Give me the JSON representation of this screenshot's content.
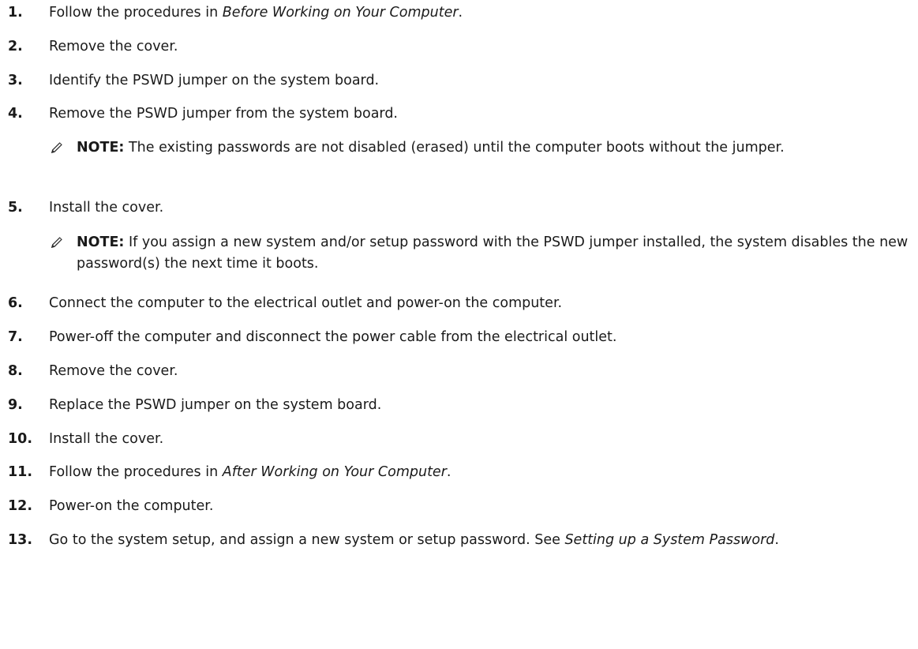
{
  "steps": [
    {
      "num": "1.",
      "before": "Follow the procedures in ",
      "italic": "Before Working on Your Computer",
      "after": "."
    },
    {
      "num": "2.",
      "text": "Remove the cover."
    },
    {
      "num": "3.",
      "text": "Identify the PSWD jumper on the system board."
    },
    {
      "num": "4.",
      "text": "Remove the PSWD jumper from the system board."
    },
    {
      "num": "5.",
      "text": "Install the cover."
    },
    {
      "num": "6.",
      "text": "Connect the computer to the electrical outlet and power-on the computer."
    },
    {
      "num": "7.",
      "text": "Power-off the computer and disconnect the power cable from the electrical outlet."
    },
    {
      "num": "8.",
      "text": "Remove the cover."
    },
    {
      "num": "9.",
      "text": "Replace the PSWD jumper on the system board."
    },
    {
      "num": "10.",
      "text": "Install the cover."
    },
    {
      "num": "11.",
      "before": "Follow the procedures in ",
      "italic": "After Working on Your Computer",
      "after": "."
    },
    {
      "num": "12.",
      "text": "Power-on the computer."
    },
    {
      "num": "13.",
      "before": "Go to the system setup, and assign a new system or setup password. See ",
      "italic": "Setting up a System Password",
      "after": "."
    }
  ],
  "notes": [
    {
      "label": "NOTE:",
      "text": " The existing passwords are not disabled (erased) until the computer boots without the jumper."
    },
    {
      "label": "NOTE:",
      "text": " If you assign a new system and/or setup password with the PSWD jumper installed, the system disables the new password(s) the next time it boots."
    }
  ]
}
